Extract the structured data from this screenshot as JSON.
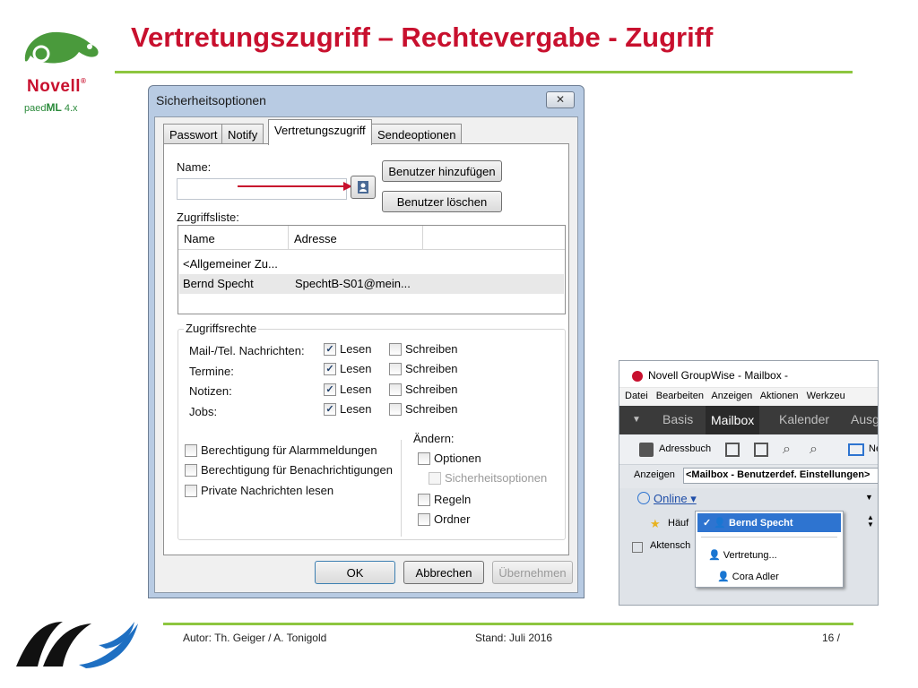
{
  "slide": {
    "title": "Vertretungszugriff – Rechtevergabe - Zugriff",
    "brand": "Novell",
    "brand_mark": "®",
    "edition_prefix": "paed",
    "edition_ml": "ML",
    "edition_suffix": "4.x"
  },
  "footer": {
    "author": "Autor: Th. Geiger / A. Tonigold",
    "date": "Stand: Juli 2016",
    "page": "16 /"
  },
  "dialog": {
    "title": "Sicherheitsoptionen",
    "close_icon": "✕",
    "tabs": [
      "Passwort",
      "Notify",
      "Vertretungszugriff",
      "Sendeoptionen"
    ],
    "name_label": "Name:",
    "name_value": "",
    "add_user": "Benutzer hinzufügen",
    "delete_user": "Benutzer löschen",
    "list_label": "Zugriffsliste:",
    "columns": [
      "Name",
      "Adresse"
    ],
    "rows": [
      {
        "name": "<Allgemeiner Zu...",
        "address": ""
      },
      {
        "name": "Bernd Specht",
        "address": "SpechtB-S01@mein..."
      }
    ],
    "rights_group": "Zugriffsrechte",
    "rights": [
      {
        "label": "Mail-/Tel. Nachrichten:",
        "read": "Lesen",
        "write": "Schreiben"
      },
      {
        "label": "Termine:",
        "read": "Lesen",
        "write": "Schreiben"
      },
      {
        "label": "Notizen:",
        "read": "Lesen",
        "write": "Schreiben"
      },
      {
        "label": "Jobs:",
        "read": "Lesen",
        "write": "Schreiben"
      }
    ],
    "permissions": [
      "Berechtigung für Alarmmeldungen",
      "Berechtigung für Benachrichtigungen",
      "Private Nachrichten lesen"
    ],
    "modify_label": "Ändern:",
    "modify_options": "Optionen",
    "modify_security": "Sicherheitsoptionen",
    "modify_rules": "Regeln",
    "modify_folder": "Ordner",
    "ok": "OK",
    "cancel": "Abbrechen",
    "apply": "Übernehmen"
  },
  "groupwise": {
    "title": "Novell GroupWise - Mailbox -",
    "menu": "Datei Bearbeiten Anzeigen Aktionen Werkzeu",
    "nav": [
      "Basis",
      "Mailbox",
      "Kalender",
      "Ausg"
    ],
    "addressbook": "Adressbuch",
    "toolbar_cut": "Ne",
    "view_label": "Anzeigen",
    "view_value": "<Mailbox - Benutzerdef. Einstellungen>",
    "online": "Online",
    "freq_label": "Häuf",
    "files_label": "Aktensch",
    "dropdown_selected": "Bernd Specht",
    "dropdown_items": [
      "Vertretung...",
      "Cora Adler"
    ]
  }
}
